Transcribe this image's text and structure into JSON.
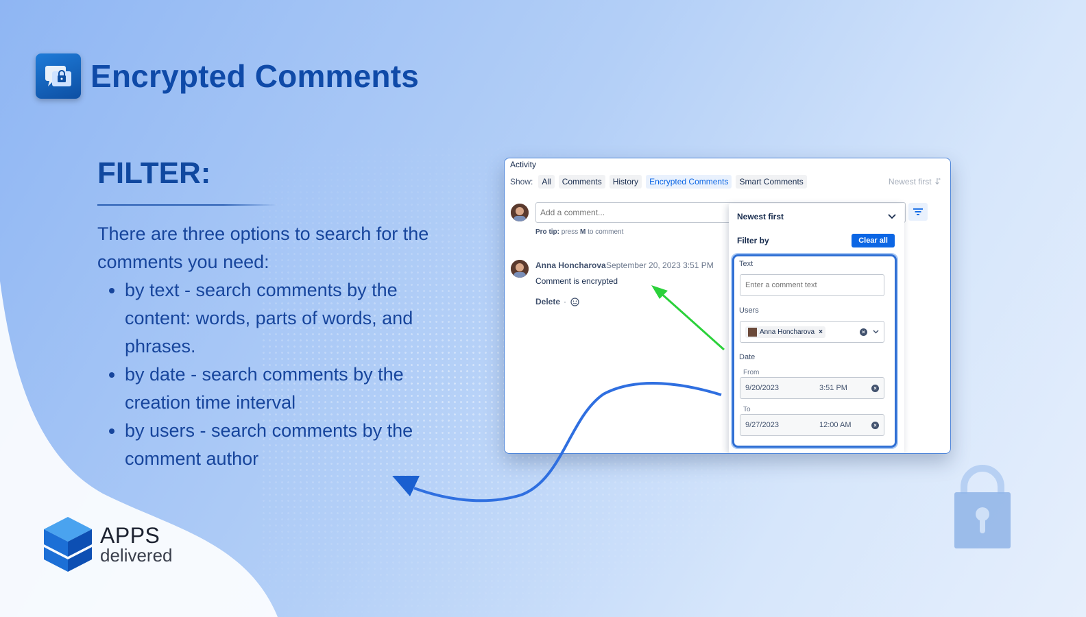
{
  "app": {
    "title": "Encrypted Comments"
  },
  "slide": {
    "heading": "FILTER:",
    "intro": "There are three options to search for the comments you need:",
    "bullets": [
      "by text - search comments by the content: words, parts of words, and phrases.",
      "by date - search comments by the creation time interval",
      "by users - search comments by the comment author"
    ]
  },
  "logo": {
    "line1": "APPS",
    "line2": "delivered"
  },
  "activity": {
    "title": "Activity",
    "show_label": "Show:",
    "tabs": [
      "All",
      "Comments",
      "History",
      "Encrypted Comments",
      "Smart Comments"
    ],
    "active_tab": "Encrypted Comments",
    "sort_label": "Newest first ↓⃗",
    "comment_placeholder": "Add a comment...",
    "protip_prefix": "Pro tip:",
    "protip_text": "press",
    "protip_key": "M",
    "protip_suffix": "to comment",
    "comment": {
      "author": "Anna Honcharova",
      "date": "September 20, 2023 3:51 PM",
      "body": "Comment is encrypted",
      "delete_label": "Delete",
      "separator": "·"
    }
  },
  "filter_dropdown": {
    "sort_value": "Newest first",
    "filter_by_label": "Filter by",
    "clear_label": "Clear all",
    "text_label": "Text",
    "text_placeholder": "Enter a comment text",
    "users_label": "Users",
    "selected_user": "Anna Honcharova",
    "date_label": "Date",
    "from_label": "From",
    "from_date": "9/20/2023",
    "from_time": "3:51 PM",
    "to_label": "To",
    "to_date": "9/27/2023",
    "to_time": "12:00 AM"
  },
  "colors": {
    "brand_blue": "#0f4aa8",
    "accent_blue": "#0c66e4",
    "highlight_green": "#2bd13a",
    "arrow_blue": "#1a5fd0"
  }
}
